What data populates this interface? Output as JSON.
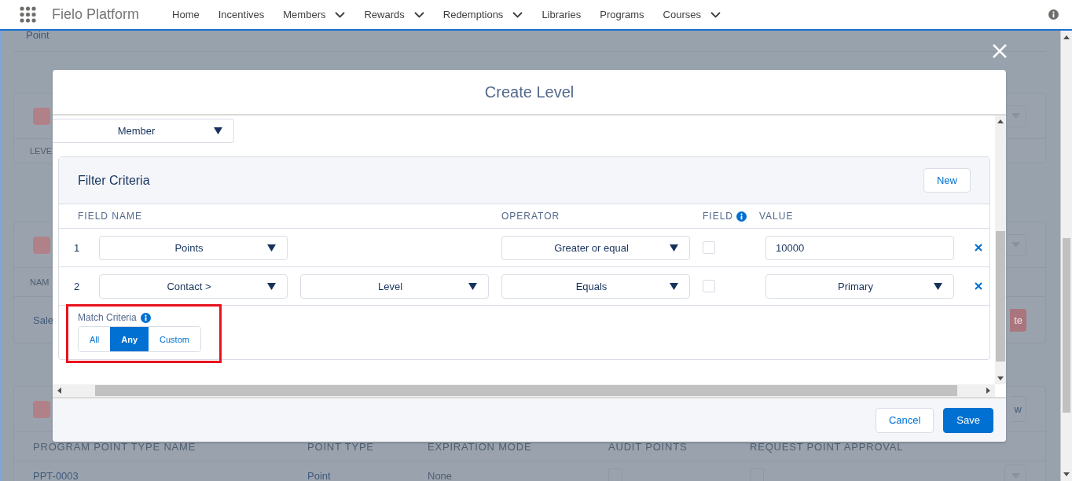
{
  "nav": {
    "app_name": "Fielo Platform",
    "items": [
      {
        "label": "Home",
        "has_menu": false
      },
      {
        "label": "Incentives",
        "has_menu": false
      },
      {
        "label": "Members",
        "has_menu": true
      },
      {
        "label": "Rewards",
        "has_menu": true
      },
      {
        "label": "Redemptions",
        "has_menu": true
      },
      {
        "label": "Libraries",
        "has_menu": false
      },
      {
        "label": "Programs",
        "has_menu": false
      },
      {
        "label": "Courses",
        "has_menu": true
      }
    ]
  },
  "background": {
    "top_link": "Point",
    "level_card": {
      "column": "LEVE"
    },
    "members_card": {
      "column": "NAM",
      "cell": "Sale",
      "button": "te"
    },
    "point_types_card": {
      "button": "w",
      "columns": [
        "PROGRAM POINT TYPE NAME",
        "POINT TYPE",
        "EXPIRATION MODE",
        "AUDIT POINTS",
        "REQUEST POINT APPROVAL"
      ],
      "row": {
        "name": "PPT-0003",
        "point_type": "Point",
        "expiration_mode": "None",
        "audit_points": false,
        "request_point_approval": false
      }
    }
  },
  "modal": {
    "title": "Create Level",
    "object_select": "Member",
    "filter": {
      "title": "Filter Criteria",
      "new_button": "New",
      "columns": {
        "field_name": "FIELD NAME",
        "operator": "OPERATOR",
        "field": "FIELD",
        "value": "VALUE"
      },
      "rows": [
        {
          "index": "1",
          "fields": [
            "Points"
          ],
          "operator": "Greater or equal",
          "field_checked": false,
          "kind": "text",
          "value": "10000"
        },
        {
          "index": "2",
          "fields": [
            "Contact >",
            "Level"
          ],
          "operator": "Equals",
          "field_checked": false,
          "kind": "select",
          "value": "Primary"
        }
      ]
    },
    "match_criteria": {
      "label": "Match Criteria",
      "highlighted": true,
      "options": [
        {
          "label": "All",
          "selected": false
        },
        {
          "label": "Any",
          "selected": true
        },
        {
          "label": "Custom",
          "selected": false
        }
      ]
    },
    "buttons": {
      "cancel": "Cancel",
      "save": "Save"
    }
  }
}
